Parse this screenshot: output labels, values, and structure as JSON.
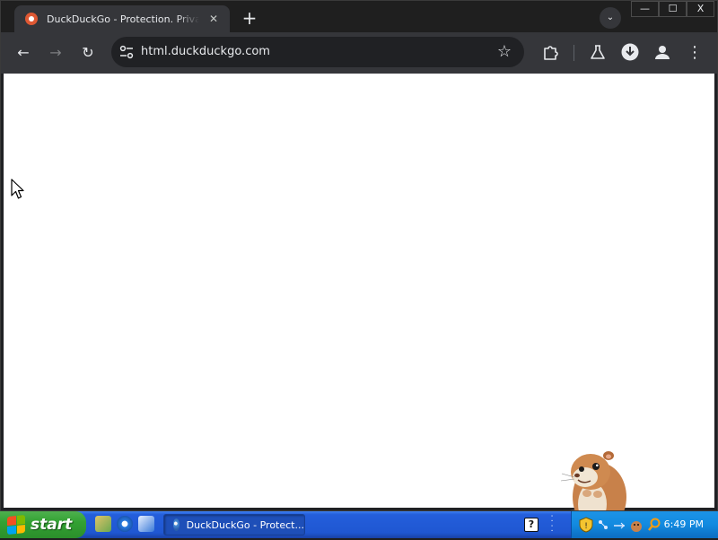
{
  "browser": {
    "tab": {
      "title": "DuckDuckGo - Protection. Privacy. Peace of mind.",
      "close_glyph": "✕",
      "favicon": "duckduckgo-favicon",
      "favicon_color": "#de5833"
    },
    "new_tab_glyph": "+",
    "tab_search_glyph": "⌄",
    "window_controls": {
      "minimize": "—",
      "maximize": "☐",
      "close": "X"
    },
    "toolbar": {
      "back_glyph": "←",
      "forward_glyph": "→",
      "reload_glyph": "↻",
      "url": "html.duckduckgo.com",
      "bookmark_glyph": "☆",
      "menu_glyph": "⋮"
    },
    "colors": {
      "frame": "#1f1f1f",
      "toolbar": "#35363a",
      "omnibox": "#202124",
      "text": "#e8eaed"
    }
  },
  "page": {
    "background": "#ffffff",
    "mascot": "hamster-assistant"
  },
  "taskbar": {
    "start_label": "start",
    "quick_launch": [
      "desktop-app-icon",
      "internet-explorer-icon",
      "outlook-express-icon"
    ],
    "task_label": "DuckDuckGo - Protect...",
    "help_glyph": "?",
    "tray_icons": [
      "security-shield-icon",
      "network-icon",
      "connection-icon",
      "hamster-tray-icon",
      "search-tray-icon"
    ],
    "clock": "6:49 PM",
    "colors": {
      "bar": "#245edb",
      "start": "#33a233",
      "tray": "#128ae0"
    }
  }
}
